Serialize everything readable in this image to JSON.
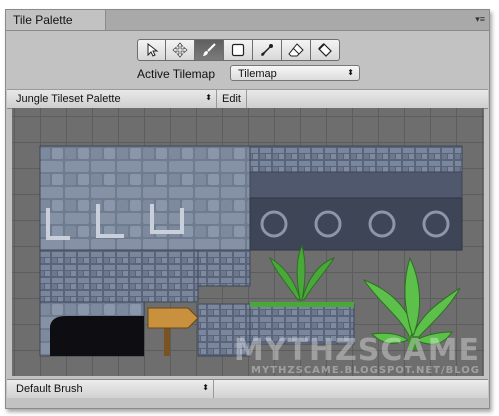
{
  "window": {
    "tab_title": "Tile Palette",
    "menu_glyph": "▾≡"
  },
  "toolbar": {
    "tools": [
      {
        "name": "select-tool",
        "icon": "arrow-cursor-icon",
        "active": false
      },
      {
        "name": "move-tool",
        "icon": "move-arrows-icon",
        "active": false
      },
      {
        "name": "paint-tool",
        "icon": "brush-icon",
        "active": true
      },
      {
        "name": "box-fill-tool",
        "icon": "rectangle-icon",
        "active": false
      },
      {
        "name": "picker-tool",
        "icon": "eyedropper-icon",
        "active": false
      },
      {
        "name": "erase-tool",
        "icon": "eraser-icon",
        "active": false
      },
      {
        "name": "flood-fill-tool",
        "icon": "paint-bucket-icon",
        "active": false
      }
    ]
  },
  "tilemap": {
    "label": "Active Tilemap",
    "value": "Tilemap",
    "arrow": "⬍"
  },
  "palette": {
    "name": "Jungle Tileset Palette",
    "arrow": "⬍",
    "edit_label": "Edit"
  },
  "brush": {
    "name": "Default Brush",
    "arrow": "⬍"
  },
  "watermark": {
    "line1": "MYTHZSCAME",
    "line2": "MYTHZSCAME.BLOGSPOT.NET/BLOG"
  },
  "colors": {
    "window_bg": "#c2c2c2",
    "grid_bg": "#6e6e6e",
    "active_tool": "#6b6b6b",
    "stone": "#6f7b8e",
    "leaf": "#4aa83a"
  }
}
